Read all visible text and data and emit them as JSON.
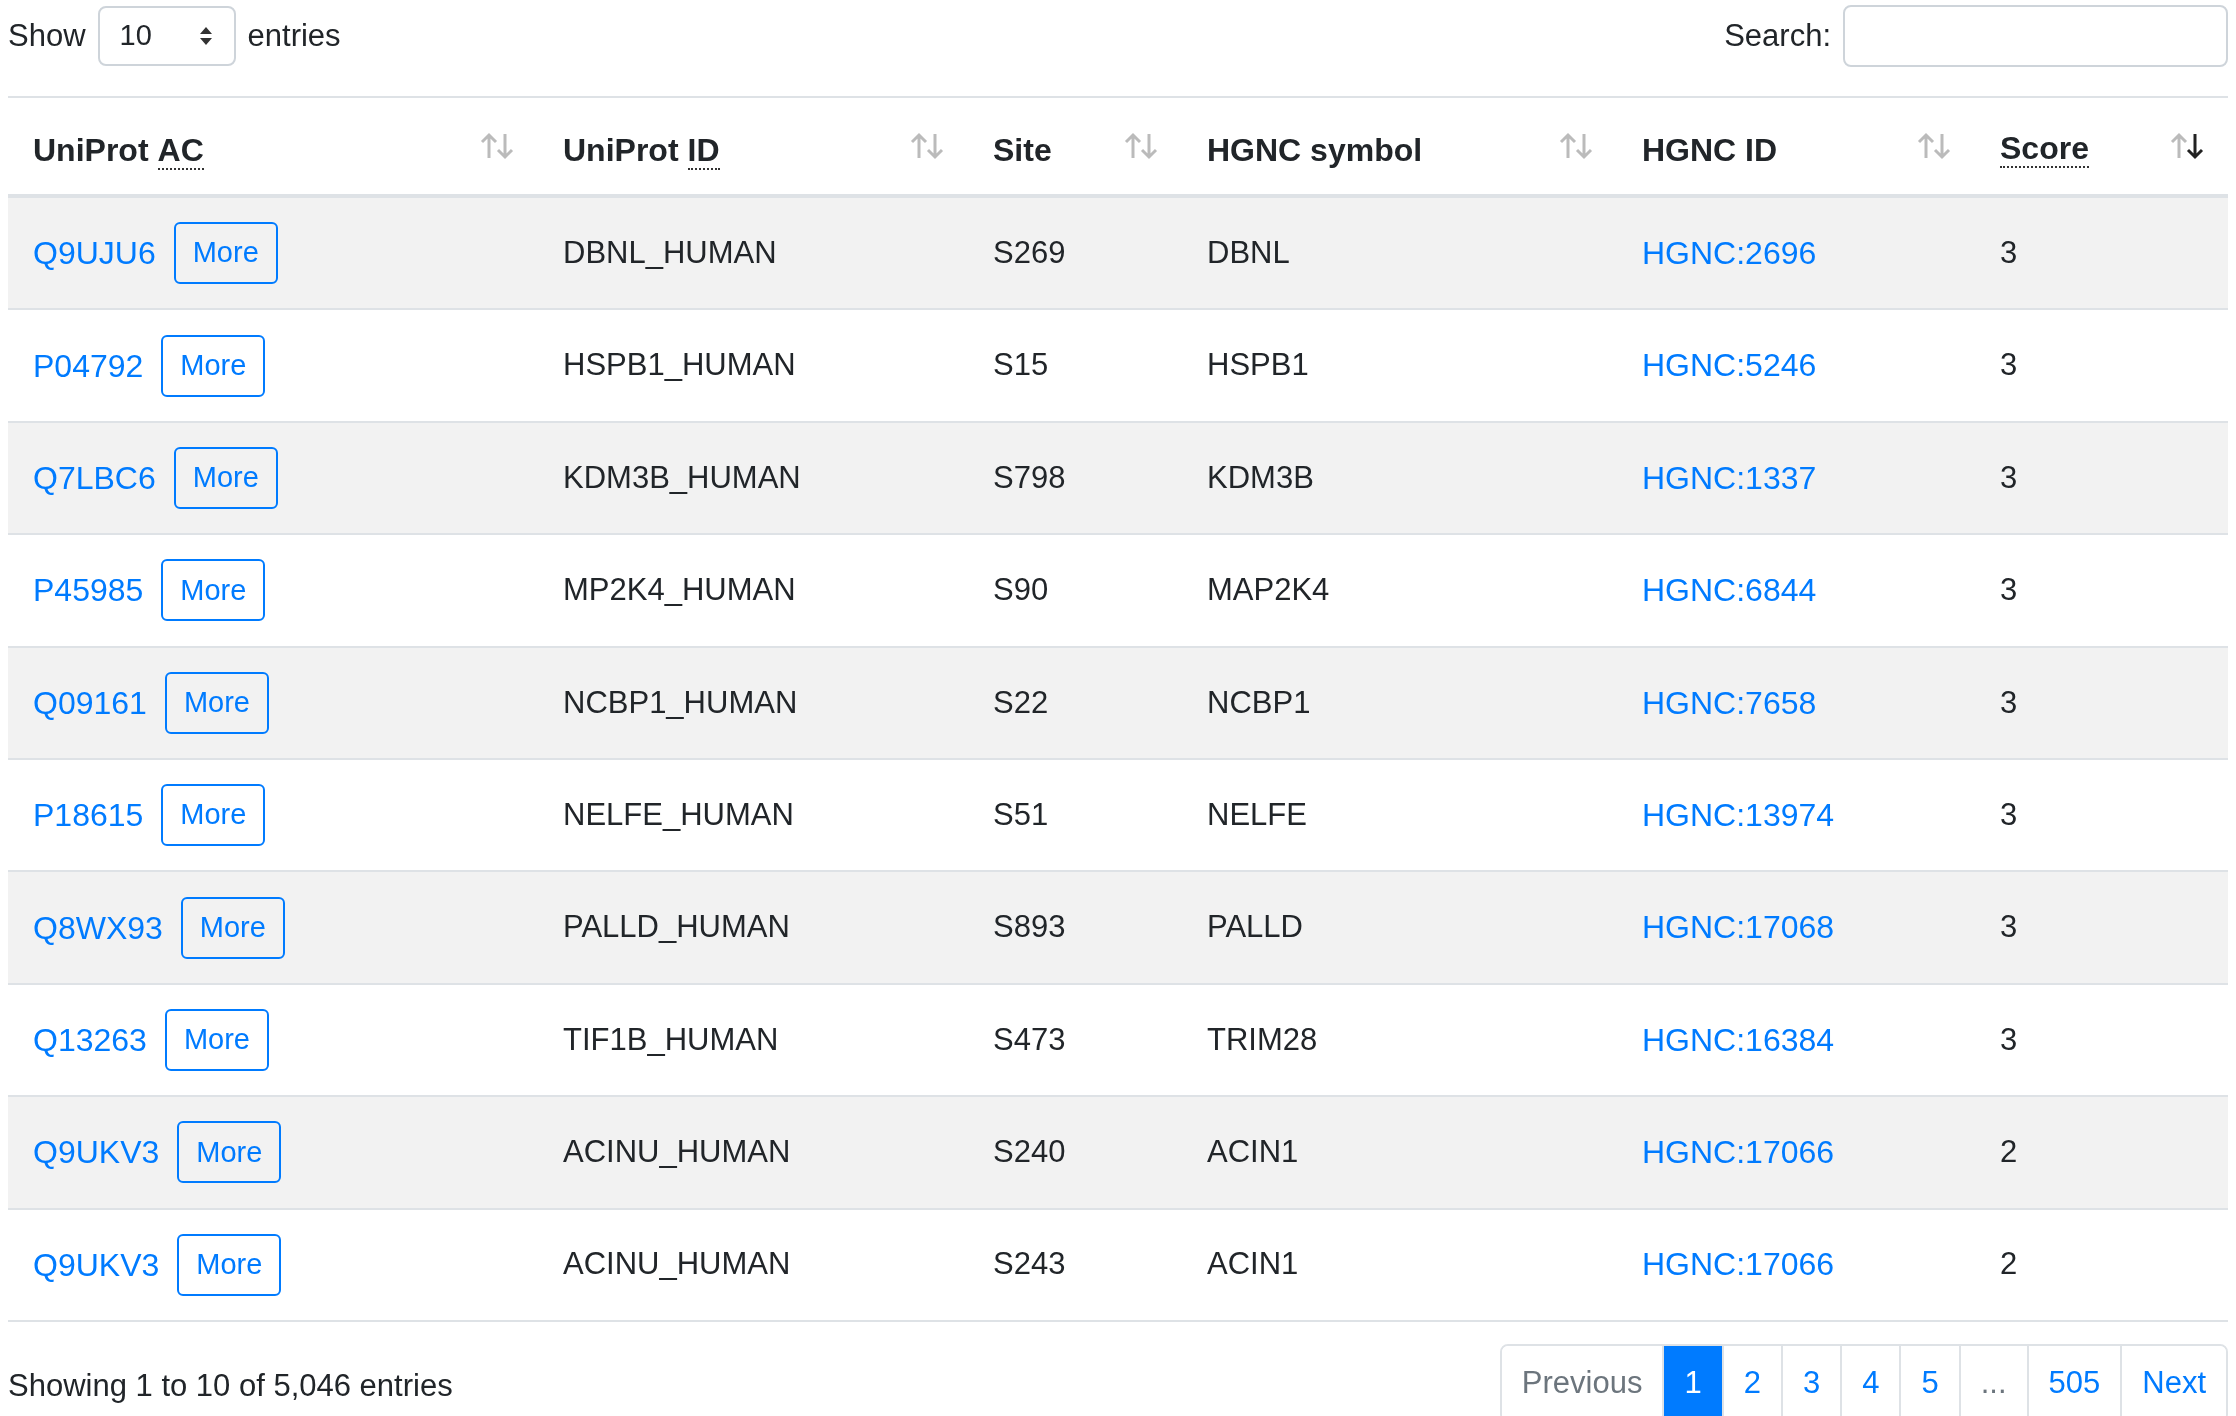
{
  "length": {
    "label_before": "Show",
    "value": "10",
    "label_after": "entries"
  },
  "search": {
    "label": "Search:"
  },
  "columns": [
    {
      "text": "UniProt",
      "abbr": "AC",
      "sorted": false
    },
    {
      "text": "UniProt",
      "abbr": "ID",
      "sorted": false
    },
    {
      "text": "Site",
      "sorted": false
    },
    {
      "text": "HGNC symbol",
      "sorted": false
    },
    {
      "text": "HGNC ID",
      "sorted": false
    },
    {
      "abbr": "Score",
      "sorted": true
    }
  ],
  "rows": [
    {
      "ac": "Q9UJU6",
      "more": "More",
      "id": "DBNL_HUMAN",
      "site": "S269",
      "symbol": "DBNL",
      "hgnc": "HGNC:2696",
      "score": "3"
    },
    {
      "ac": "P04792",
      "more": "More",
      "id": "HSPB1_HUMAN",
      "site": "S15",
      "symbol": "HSPB1",
      "hgnc": "HGNC:5246",
      "score": "3"
    },
    {
      "ac": "Q7LBC6",
      "more": "More",
      "id": "KDM3B_HUMAN",
      "site": "S798",
      "symbol": "KDM3B",
      "hgnc": "HGNC:1337",
      "score": "3"
    },
    {
      "ac": "P45985",
      "more": "More",
      "id": "MP2K4_HUMAN",
      "site": "S90",
      "symbol": "MAP2K4",
      "hgnc": "HGNC:6844",
      "score": "3"
    },
    {
      "ac": "Q09161",
      "more": "More",
      "id": "NCBP1_HUMAN",
      "site": "S22",
      "symbol": "NCBP1",
      "hgnc": "HGNC:7658",
      "score": "3"
    },
    {
      "ac": "P18615",
      "more": "More",
      "id": "NELFE_HUMAN",
      "site": "S51",
      "symbol": "NELFE",
      "hgnc": "HGNC:13974",
      "score": "3"
    },
    {
      "ac": "Q8WX93",
      "more": "More",
      "id": "PALLD_HUMAN",
      "site": "S893",
      "symbol": "PALLD",
      "hgnc": "HGNC:17068",
      "score": "3"
    },
    {
      "ac": "Q13263",
      "more": "More",
      "id": "TIF1B_HUMAN",
      "site": "S473",
      "symbol": "TRIM28",
      "hgnc": "HGNC:16384",
      "score": "3"
    },
    {
      "ac": "Q9UKV3",
      "more": "More",
      "id": "ACINU_HUMAN",
      "site": "S240",
      "symbol": "ACIN1",
      "hgnc": "HGNC:17066",
      "score": "2"
    },
    {
      "ac": "Q9UKV3",
      "more": "More",
      "id": "ACINU_HUMAN",
      "site": "S243",
      "symbol": "ACIN1",
      "hgnc": "HGNC:17066",
      "score": "2"
    }
  ],
  "info": "Showing 1 to 10 of 5,046 entries",
  "pagination": [
    {
      "label": "Previous",
      "selected": false,
      "disabled": true
    },
    {
      "label": "1",
      "selected": true,
      "disabled": false
    },
    {
      "label": "2",
      "selected": false,
      "disabled": false
    },
    {
      "label": "3",
      "selected": false,
      "disabled": false
    },
    {
      "label": "4",
      "selected": false,
      "disabled": false
    },
    {
      "label": "5",
      "selected": false,
      "disabled": false
    },
    {
      "label": "...",
      "selected": false,
      "disabled": true
    },
    {
      "label": "505",
      "selected": false,
      "disabled": false
    },
    {
      "label": "Next",
      "selected": false,
      "disabled": false
    }
  ]
}
